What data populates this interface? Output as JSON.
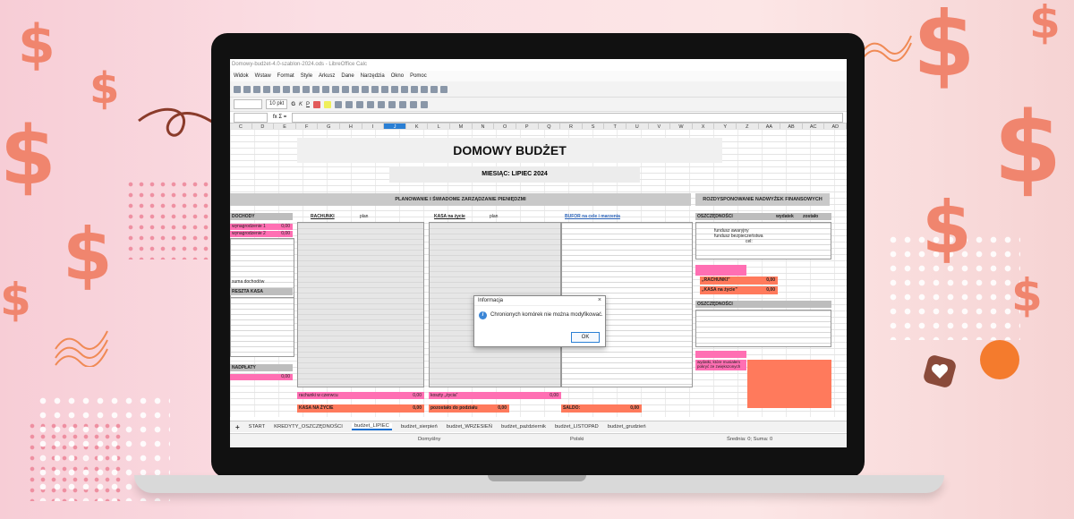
{
  "window": {
    "title": "Domowy-budżet-4.0-szablon-2024.ods - LibreOffice Calc"
  },
  "menu": [
    "Widok",
    "Wstaw",
    "Format",
    "Style",
    "Arkusz",
    "Dane",
    "Narzędzia",
    "Okno",
    "Pomoc"
  ],
  "toolbar": {
    "font_size": "10 pkt",
    "bold": "G",
    "italic": "K",
    "underline": "P"
  },
  "formula": {
    "cell_ref": "",
    "functions": "fx Σ ="
  },
  "columns": [
    "C",
    "D",
    "E",
    "F",
    "G",
    "H",
    "I",
    "J",
    "K",
    "L",
    "M",
    "N",
    "O",
    "P",
    "Q",
    "R",
    "S",
    "T",
    "U",
    "V",
    "W",
    "X",
    "Y",
    "Z",
    "AA",
    "AB",
    "AC",
    "AD"
  ],
  "selected_column": "J",
  "sheet": {
    "title": "DOMOWY BUDŻET",
    "month": "MIESIĄC: LIPIEC 2024",
    "plan_header": "PLANOWANIE I ŚWIADOME ZARZĄDZANIE PIENIĘDZMI",
    "surplus_header": "ROZDYSPONOWANIE NADWYŻEK FINANSOWYCH",
    "income_label": "DOCHODY",
    "income_item1": "wynagrodzenie 1",
    "income_item2": "wynagrodzenie 2",
    "income_value": "0,00",
    "income_sum_label": "suma dochodów",
    "rachunki_label": "RACHUNKI",
    "kasa_label": "KASA na życie",
    "kasa_extra_label": "BUFOR na cele i marzenia",
    "plan_col": "plan",
    "wydatek_col": "wydatek",
    "zostalo_col": "zostało",
    "zero": "0,00",
    "rachunki_total_label": "rachunki w czerwcu",
    "kosztyzycia_label": "koszty „życia”",
    "kasa_na_zycie_label": "KASA NA ŻYCIE",
    "pozostalo_label": "pozostało do podziału",
    "saldo_label": "SALDO:",
    "leftover_label": "RESZTA KASA",
    "oszczednosci_label": "OSZCZĘDNOŚCI",
    "fundusz_awaryjny": "fundusz awaryjny",
    "fundusz_bezp": "fundusz bezpieczeństwa",
    "cel": "cel:",
    "rachunki_left_label": "„RACHUNKI”",
    "kasa_left_label": "„KASA na życie”",
    "nadplata_label": "NADPŁATY",
    "rozliczenie_label": "wydatki, które musiałem pokryć ze zwiększonych"
  },
  "dialog": {
    "title": "Informacja",
    "message": "Chronionych komórek nie można modyfikować.",
    "ok": "OK"
  },
  "tabs": [
    "START",
    "KREDYTY_OSZCZĘDNOŚCI",
    "budżet_LIPIEC",
    "budżet_sierpień",
    "budżet_WRZESIEŃ",
    "budżet_październik",
    "budżet_LISTOPAD",
    "budżet_grudzień"
  ],
  "active_tab": "budżet_LIPIEC",
  "status": {
    "style": "Domyślny",
    "language": "Polski",
    "summary": "Średnia: 0; Suma: 0"
  },
  "colors": {
    "accent": "#ff6fb3",
    "salmon": "#ff7a5c",
    "selection": "#2a7fd4"
  }
}
